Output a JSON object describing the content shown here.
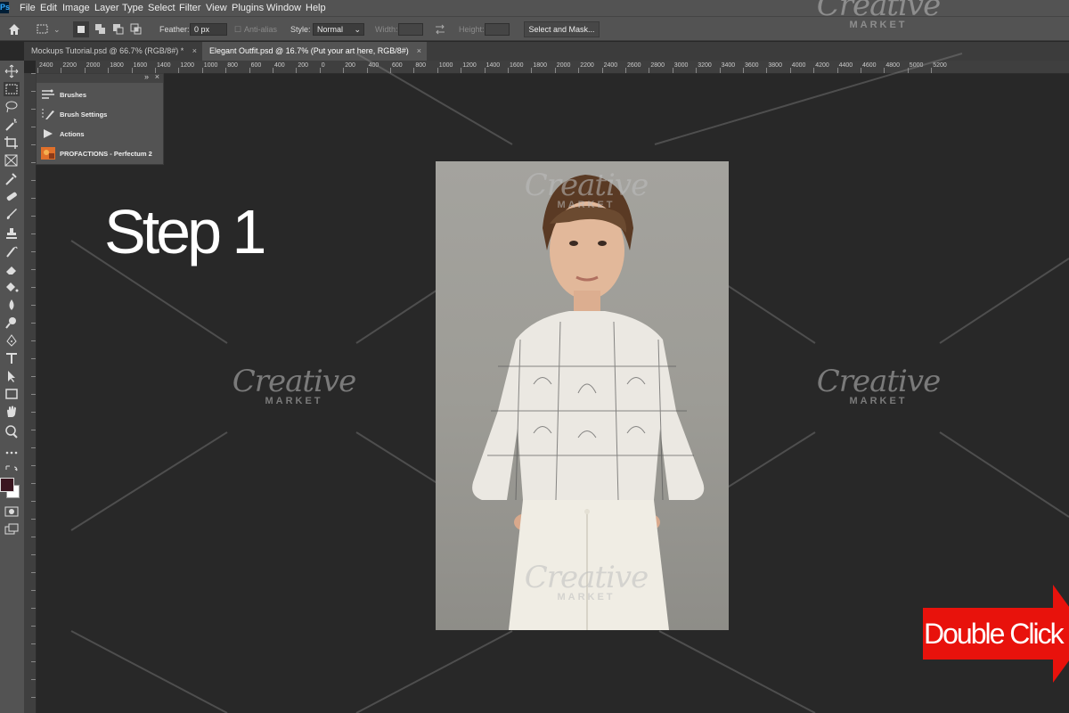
{
  "menu": {
    "items": [
      "File",
      "Edit",
      "Image",
      "Layer",
      "Type",
      "Select",
      "Filter",
      "View",
      "Plugins",
      "Window",
      "Help"
    ]
  },
  "options": {
    "feather_label": "Feather:",
    "feather_value": "0 px",
    "antialias_label": "Anti-alias",
    "style_label": "Style:",
    "style_value": "Normal",
    "width_label": "Width:",
    "height_label": "Height:",
    "select_mask_button": "Select and Mask..."
  },
  "tabs": [
    {
      "label": "Mockups Tutorial.psd @ 66.7% (RGB/8#) *"
    },
    {
      "label": "Elegant Outfit.psd @ 16.7% (Put your art here, RGB/8#)"
    }
  ],
  "ruler": {
    "labels": [
      "2400",
      "2200",
      "2000",
      "1800",
      "1600",
      "1400",
      "1200",
      "1000",
      "800",
      "600",
      "400",
      "200",
      "0",
      "200",
      "400",
      "600",
      "800",
      "1000",
      "1200",
      "1400",
      "1600",
      "1800",
      "2000",
      "2200",
      "2400",
      "2600",
      "2800",
      "3000",
      "3200",
      "3400",
      "3600",
      "3800",
      "4000",
      "4200",
      "4400",
      "4600",
      "4800",
      "5000",
      "5200"
    ]
  },
  "panel": {
    "items": [
      {
        "label": "Brushes",
        "icon": "brushes-icon"
      },
      {
        "label": "Brush Settings",
        "icon": "brush-settings-icon"
      },
      {
        "label": "Actions",
        "icon": "play-icon"
      },
      {
        "label": "PROFACTIONS - Perfectum 2",
        "icon": "plugin-thumbnail-icon"
      }
    ]
  },
  "canvas": {
    "step_title": "Step 1",
    "cta_text": "Double Click h",
    "cta_color": "#e8120c"
  },
  "watermark": {
    "line1": "Creative",
    "line2": "MARKET"
  }
}
